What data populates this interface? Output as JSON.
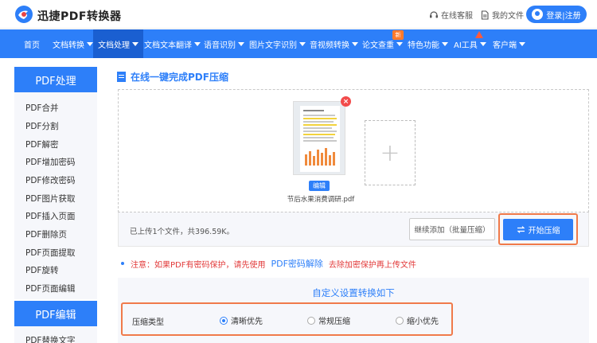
{
  "header": {
    "brand": "迅捷PDF转换器",
    "service_label": "在线客服",
    "files_label": "我的文件",
    "login_label": "登录|注册"
  },
  "nav": {
    "items": [
      {
        "label": "首页"
      },
      {
        "label": "文档转换"
      },
      {
        "label": "文档处理"
      },
      {
        "label": "文档文本翻译"
      },
      {
        "label": "语音识别"
      },
      {
        "label": "图片文字识别"
      },
      {
        "label": "音视频转换"
      },
      {
        "label": "论文查重"
      },
      {
        "label": "特色功能"
      },
      {
        "label": "AI工具"
      },
      {
        "label": "客户端"
      }
    ],
    "new_badge": "新"
  },
  "sidebar": {
    "section1_title": "PDF处理",
    "items": [
      "PDF合并",
      "PDF分割",
      "PDF解密",
      "PDF增加密码",
      "PDF修改密码",
      "PDF图片获取",
      "PDF插入页面",
      "PDF删除页",
      "PDF页面提取",
      "PDF旋转",
      "PDF页面编辑"
    ],
    "section2_title": "PDF编辑",
    "section2_first_item": "PDF替换文字"
  },
  "main": {
    "title": "在线一键完成PDF压缩",
    "file": {
      "edit_label": "编辑",
      "name": "节后水果消费调研.pdf"
    },
    "info": "已上传1个文件，共396.59K。",
    "continue_label": "继续添加（批量压缩）",
    "start_label": "开始压缩",
    "notice_prefix": "注意：如果PDF有密码保护，请先使用",
    "notice_link": "PDF密码解除",
    "notice_suffix": "去除加密保护再上传文件",
    "settings_title": "自定义设置转换如下",
    "compress_type_label": "压缩类型",
    "options": [
      "清晰优先",
      "常规压缩",
      "缩小优先"
    ],
    "selected_option": "清晰优先"
  },
  "colors": {
    "primary": "#2d7ff9",
    "highlight": "#f07a4a",
    "notice": "#e23a3a"
  }
}
